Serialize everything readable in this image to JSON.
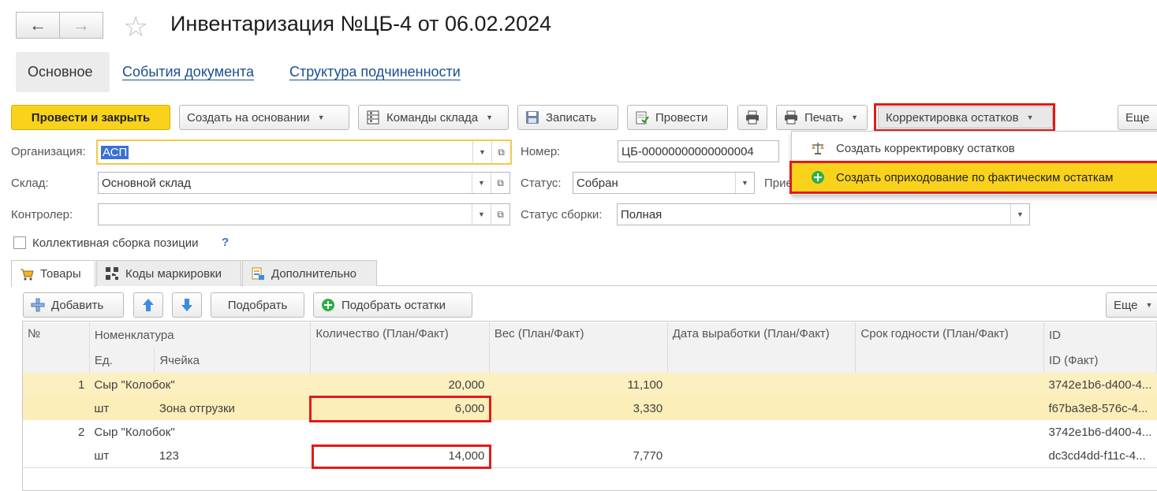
{
  "window": {
    "title": "Инвентаризация №ЦБ-4 от 06.02.2024"
  },
  "nav": {
    "back_glyph": "←",
    "forward_glyph": "→",
    "favorite_glyph": "☆"
  },
  "top_tabs": {
    "main": "Основное",
    "events": "События документа",
    "structure": "Структура подчиненности"
  },
  "toolbar": {
    "post_close": "Провести и закрыть",
    "create_based": "Создать на основании",
    "warehouse_cmds": "Команды склада",
    "save": "Записать",
    "post": "Провести",
    "print": "Печать",
    "adjust": "Корректировка остатков",
    "more": "Еще"
  },
  "adjust_menu": {
    "item1": "Создать корректировку остатков",
    "item2": "Создать оприходование по фактическим остаткам"
  },
  "form": {
    "org_label": "Организация:",
    "org_value": "АСП",
    "number_label": "Номер:",
    "number_value": "ЦБ-00000000000000004",
    "warehouse_label": "Склад:",
    "warehouse_value": "Основной склад",
    "status_label": "Статус:",
    "status_value": "Собран",
    "resp_label": "Прие",
    "controller_label": "Контролер:",
    "controller_value": "",
    "assembly_label": "Статус сборки:",
    "assembly_value": "Полная",
    "collective_label": "Коллективная сборка позиции",
    "help_glyph": "?"
  },
  "sub_tabs": {
    "goods": "Товары",
    "codes": "Коды маркировки",
    "extra": "Дополнительно"
  },
  "table_toolbar": {
    "add": "Добавить",
    "pick": "Подобрать",
    "pick_rest": "Подобрать остатки",
    "more": "Еще"
  },
  "table": {
    "headers": {
      "no": "№",
      "nomenclature": "Номенклатура",
      "unit": "Ед.",
      "cell": "Ячейка",
      "qty": "Количество (План/Факт)",
      "weight": "Вес (План/Факт)",
      "prod_date": "Дата выработки (План/Факт)",
      "expiry": "Срок годности (План/Факт)",
      "id": "ID",
      "id_fact": "ID (Факт)"
    },
    "rows": [
      {
        "no": "1",
        "name": "Сыр \"Колобок\"",
        "unit": "шт",
        "cell": "Зона отгрузки",
        "qty_plan": "20,000",
        "qty_fact": "6,000",
        "w_plan": "11,100",
        "w_fact": "3,330",
        "id": "3742e1b6-d400-4...",
        "id_fact": "f67ba3e8-576c-4..."
      },
      {
        "no": "2",
        "name": "Сыр \"Колобок\"",
        "unit": "шт",
        "cell": "123",
        "qty_plan": "",
        "qty_fact": "14,000",
        "w_plan": "",
        "w_fact": "7,770",
        "id": "3742e1b6-d400-4...",
        "id_fact": "dc3cd4dd-f11c-4..."
      }
    ]
  },
  "colors": {
    "accent_yellow": "#f9d21c",
    "highlight_red": "#e21a1a",
    "link_blue": "#1a4f8f"
  }
}
